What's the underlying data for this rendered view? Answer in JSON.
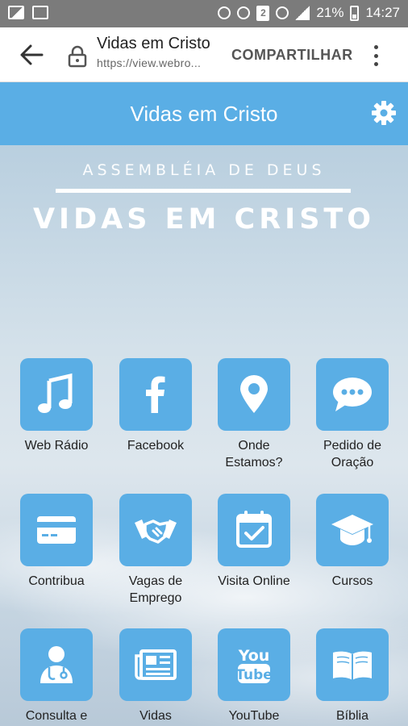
{
  "status_bar": {
    "battery": "21%",
    "time": "14:27",
    "badge": "2"
  },
  "browser": {
    "title": "Vidas em Cristo",
    "url": "https://view.webro...",
    "share_label": "COMPARTILHAR"
  },
  "app": {
    "title": "Vidas em Cristo"
  },
  "hero": {
    "subtitle": "ASSEMBLÉIA DE DEUS",
    "title": "VIDAS EM CRISTO"
  },
  "tiles": [
    {
      "label": "Web Rádio",
      "icon": "music-note-icon"
    },
    {
      "label": "Facebook",
      "icon": "facebook-icon"
    },
    {
      "label": "Onde Estamos?",
      "icon": "map-pin-icon"
    },
    {
      "label": "Pedido de Oração",
      "icon": "chat-bubble-icon"
    },
    {
      "label": "Contribua",
      "icon": "credit-card-icon"
    },
    {
      "label": "Vagas de Emprego",
      "icon": "handshake-icon"
    },
    {
      "label": "Visita Online",
      "icon": "calendar-check-icon"
    },
    {
      "label": "Cursos",
      "icon": "graduation-cap-icon"
    },
    {
      "label": "Consulta e",
      "icon": "doctor-icon"
    },
    {
      "label": "Vidas",
      "icon": "newspaper-icon"
    },
    {
      "label": "YouTube",
      "icon": "youtube-icon"
    },
    {
      "label": "Bíblia",
      "icon": "bible-icon"
    }
  ],
  "colors": {
    "accent": "#5aaee5",
    "status_bar": "#7b7b7b"
  }
}
